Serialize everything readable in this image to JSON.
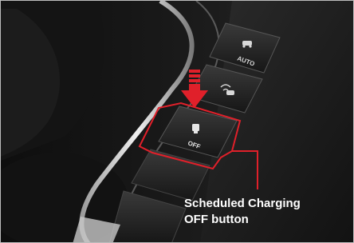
{
  "photo": {
    "subject": "car-center-console-button-strip",
    "buttons": [
      {
        "icon": "car-auto-hold-icon",
        "label": "AUTO"
      },
      {
        "icon": "parking-sensor-icon",
        "label": ""
      },
      {
        "icon": "scheduled-charging-icon",
        "label": "OFF"
      }
    ]
  },
  "callout": {
    "line1": "Scheduled Charging",
    "line2": "OFF button",
    "highlight_color": "#e0202a",
    "arrow_color": "#e0202a"
  }
}
